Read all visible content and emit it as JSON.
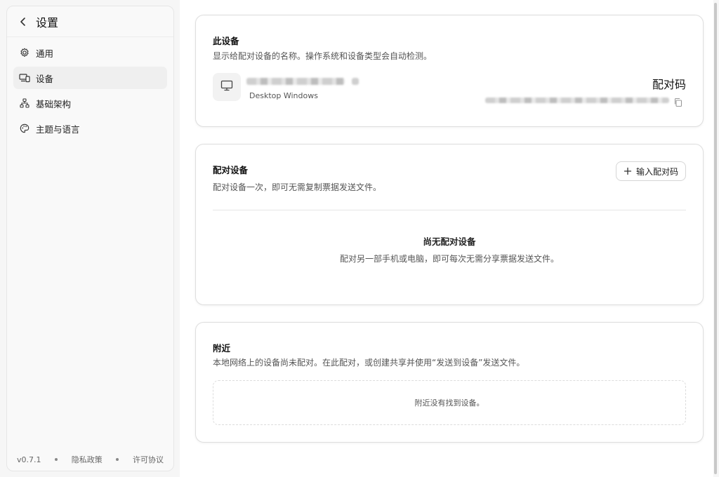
{
  "sidebar": {
    "title": "设置",
    "items": [
      {
        "label": "通用",
        "icon": "gear-icon"
      },
      {
        "label": "设备",
        "icon": "devices-icon",
        "active": true
      },
      {
        "label": "基础架构",
        "icon": "network-icon"
      },
      {
        "label": "主题与语言",
        "icon": "palette-icon"
      }
    ],
    "footer": {
      "version": "v0.7.1",
      "privacy": "隐私政策",
      "license": "许可协议"
    }
  },
  "this_device": {
    "title": "此设备",
    "description": "显示给配对设备的名称。操作系统和设备类型会自动检测。",
    "device_type": "Desktop Windows",
    "pair_code_label": "配对码"
  },
  "paired_devices": {
    "title": "配对设备",
    "description": "配对设备一次，即可无需复制票据发送文件。",
    "enter_code_button": "输入配对码",
    "empty_title": "尚无配对设备",
    "empty_description": "配对另一部手机或电脑，即可每次无需分享票据发送文件。"
  },
  "nearby": {
    "title": "附近",
    "description": "本地网络上的设备尚未配对。在此配对，或创建共享并使用“发送到设备”发送文件。",
    "empty_text": "附近没有找到设备。"
  }
}
